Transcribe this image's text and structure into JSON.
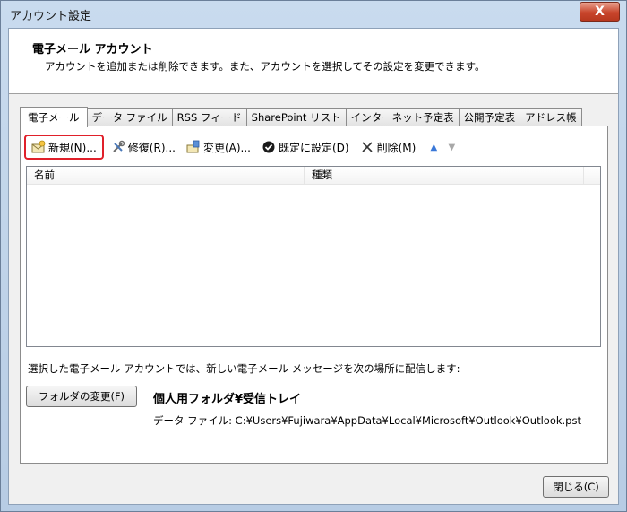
{
  "window": {
    "title": "アカウント設定",
    "close_symbol": "X"
  },
  "header": {
    "title": "電子メール アカウント",
    "description": "アカウントを追加または削除できます。また、アカウントを選択してその設定を変更できます。"
  },
  "tabs": [
    {
      "label": "電子メール",
      "active": true
    },
    {
      "label": "データ ファイル"
    },
    {
      "label": "RSS フィード"
    },
    {
      "label": "SharePoint リスト"
    },
    {
      "label": "インターネット予定表"
    },
    {
      "label": "公開予定表"
    },
    {
      "label": "アドレス帳"
    }
  ],
  "toolbar": {
    "new_label": "新規(N)...",
    "repair_label": "修復(R)...",
    "change_label": "変更(A)...",
    "default_label": "既定に設定(D)",
    "delete_label": "削除(M)",
    "up_icon": "arrow-up-icon",
    "down_icon": "arrow-down-icon"
  },
  "list": {
    "columns": [
      "名前",
      "種類"
    ],
    "rows": []
  },
  "delivery": {
    "text": "選択した電子メール アカウントでは、新しい電子メール メッセージを次の場所に配信します:",
    "change_folder_label": "フォルダの変更(F)",
    "folder_name": "個人用フォルダ¥受信トレイ",
    "data_file": "データ ファイル: C:¥Users¥Fujiwara¥AppData¥Local¥Microsoft¥Outlook¥Outlook.pst"
  },
  "footer": {
    "close_label": "閉じる(C)"
  },
  "colors": {
    "highlight": "#e0202a",
    "title_close": "#c8452c"
  }
}
